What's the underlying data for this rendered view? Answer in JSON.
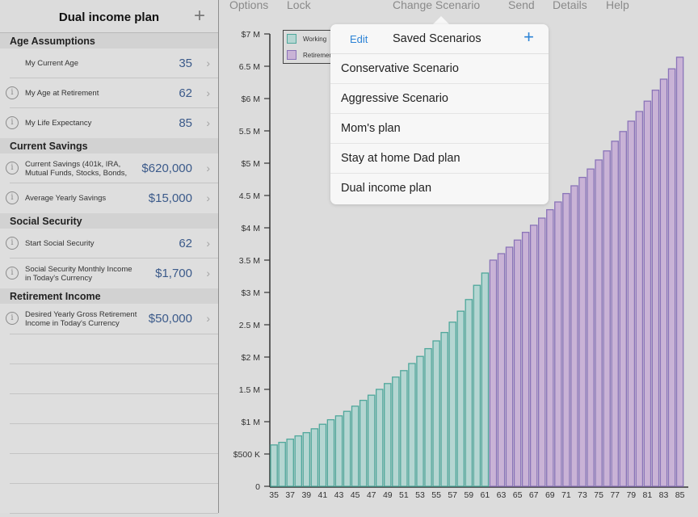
{
  "sidebar": {
    "title": "Dual income plan",
    "add_icon": "plus-icon",
    "sections": [
      {
        "header": "Age Assumptions",
        "rows": [
          {
            "label": "My Current Age",
            "value": "35",
            "info": false
          },
          {
            "label": "My Age at Retirement",
            "value": "62",
            "info": true
          },
          {
            "label": "My Life Expectancy",
            "value": "85",
            "info": true
          }
        ]
      },
      {
        "header": "Current Savings",
        "rows": [
          {
            "label": "Current Savings (401k, IRA, Mutual Funds, Stocks, Bonds,",
            "value": "$620,000",
            "info": true
          },
          {
            "label": "Average Yearly Savings",
            "value": "$15,000",
            "info": true
          }
        ]
      },
      {
        "header": "Social Security",
        "rows": [
          {
            "label": "Start Social Security",
            "value": "62",
            "info": true
          },
          {
            "label": "Social Security Monthly Income in Today's Currency",
            "value": "$1,700",
            "info": true
          }
        ]
      },
      {
        "header": "Retirement Income",
        "rows": [
          {
            "label": "Desired Yearly Gross Retirement Income in Today's Currency",
            "value": "$50,000",
            "info": true
          }
        ]
      }
    ],
    "info_glyph": "i",
    "chevron_glyph": "›"
  },
  "toolbar": {
    "options": "Options",
    "lock": "Lock",
    "change_scenario": "Change Scenario",
    "send": "Send",
    "details": "Details",
    "help": "Help"
  },
  "popover": {
    "edit": "Edit",
    "title": "Saved Scenarios",
    "add": "+",
    "items": [
      "Conservative Scenario",
      "Aggressive Scenario",
      "Mom's plan",
      "Stay at home Dad plan",
      "Dual income plan"
    ]
  },
  "colors": {
    "working_fill": "#b5d6d2",
    "working_stroke": "#4fa79b",
    "retirement_fill": "#c9b3d6",
    "retirement_stroke": "#8a74b8",
    "accent": "#2c83d6",
    "value_text": "#3b5a8a"
  },
  "chart_data": {
    "type": "bar",
    "title": "",
    "xlabel": "",
    "ylabel": "",
    "ylim": [
      0,
      7000000
    ],
    "yticks": [
      0,
      500000,
      1000000,
      1500000,
      2000000,
      2500000,
      3000000,
      3500000,
      4000000,
      4500000,
      5000000,
      5500000,
      6000000,
      6500000,
      7000000
    ],
    "ytick_labels": [
      "0",
      "$500 K",
      "$1 M",
      "1.5 M",
      "$2 M",
      "2.5 M",
      "$3 M",
      "3.5 M",
      "$4 M",
      "4.5 M",
      "$5 M",
      "5.5 M",
      "$6 M",
      "6.5 M",
      "$7 M"
    ],
    "xtick_labels": [
      "35",
      "37",
      "39",
      "41",
      "43",
      "45",
      "47",
      "49",
      "51",
      "53",
      "55",
      "57",
      "59",
      "61",
      "63",
      "65",
      "67",
      "69",
      "71",
      "73",
      "75",
      "77",
      "79",
      "81",
      "83",
      "85"
    ],
    "legend": {
      "placement": "top-left",
      "entries": [
        "Working",
        "Retirement"
      ]
    },
    "grid": false,
    "series": [
      {
        "name": "Working",
        "x": [
          35,
          36,
          37,
          38,
          39,
          40,
          41,
          42,
          43,
          44,
          45,
          46,
          47,
          48,
          49,
          50,
          51,
          52,
          53,
          54,
          55,
          56,
          57,
          58,
          59,
          60,
          61
        ],
        "values": [
          640000,
          680000,
          730000,
          780000,
          830000,
          890000,
          960000,
          1030000,
          1090000,
          1160000,
          1240000,
          1330000,
          1410000,
          1500000,
          1590000,
          1690000,
          1790000,
          1900000,
          2010000,
          2130000,
          2250000,
          2380000,
          2540000,
          2710000,
          2890000,
          3110000,
          3300000
        ]
      },
      {
        "name": "Retirement",
        "x": [
          62,
          63,
          64,
          65,
          66,
          67,
          68,
          69,
          70,
          71,
          72,
          73,
          74,
          75,
          76,
          77,
          78,
          79,
          80,
          81,
          82,
          83,
          84,
          85
        ],
        "values": [
          3500000,
          3600000,
          3700000,
          3810000,
          3930000,
          4040000,
          4150000,
          4280000,
          4400000,
          4530000,
          4650000,
          4780000,
          4910000,
          5050000,
          5190000,
          5340000,
          5490000,
          5650000,
          5800000,
          5960000,
          6130000,
          6300000,
          6460000,
          6640000
        ]
      }
    ]
  }
}
